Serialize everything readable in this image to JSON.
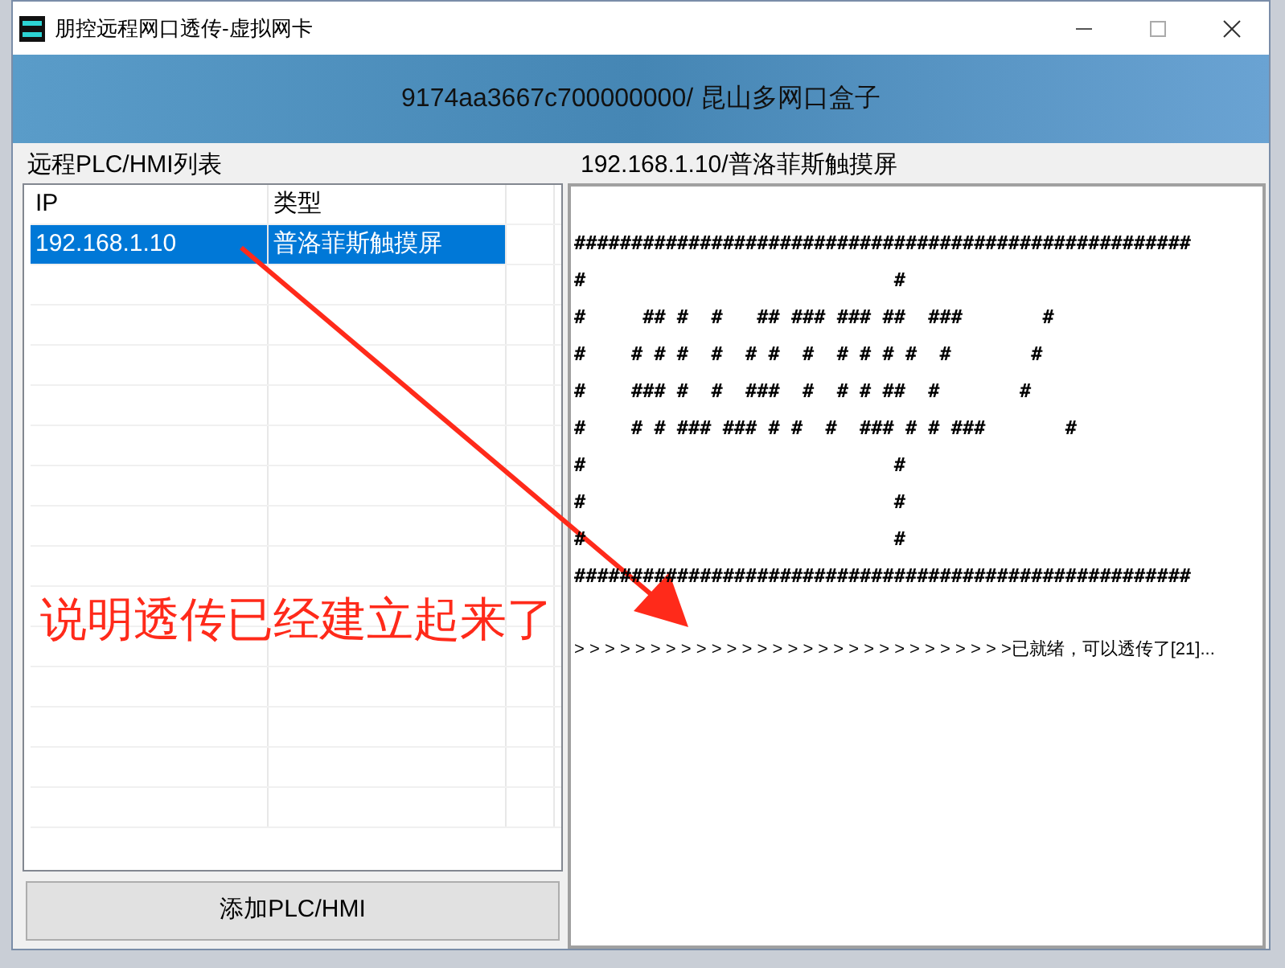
{
  "window": {
    "title": "朋控远程网口透传-虚拟网卡"
  },
  "header": {
    "text": "9174aa3667c700000000/ 昆山多网口盒子"
  },
  "device_list": {
    "title": "远程PLC/HMI列表",
    "columns": [
      "IP",
      "类型"
    ],
    "rows": [
      {
        "cells": [
          "192.168.1.10",
          "普洛菲斯触摸屏"
        ],
        "selected": true
      }
    ]
  },
  "add_button": "添加PLC/HMI",
  "console": {
    "title": "192.168.1.10/普洛菲斯触摸屏",
    "lines": [
      "######################################################",
      "#                           #",
      "#     ## #  #   ## ### ### ##  ###       #",
      "#    # # #  #  # #  #  # # # #  #       #",
      "#    ### #  #  ###  #  # # ##  #       #",
      "#    # # ### ### # #  #  ### # # ###       #",
      "#                           #",
      "#                           #",
      "#                           #",
      "######################################################"
    ],
    "status": "> > > > > > > > > > > > > > > > > > > > > > > > > > > > >已就绪，可以透传了[21]..."
  },
  "annotation": {
    "text": "说明透传已经建立起来了"
  }
}
